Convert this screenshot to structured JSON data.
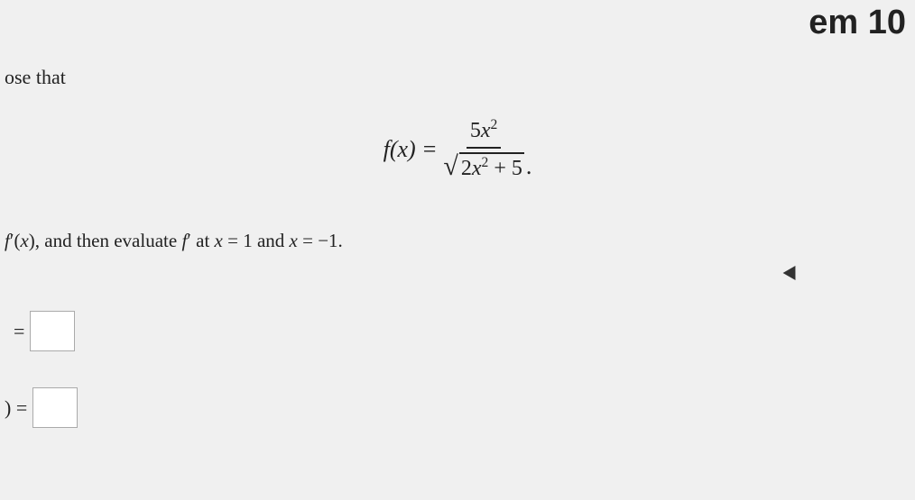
{
  "page": {
    "background_color": "#efefef",
    "top_heading": "em 10",
    "intro_text": "ose that",
    "formula": {
      "lhs": "f(x)",
      "equals": "=",
      "numerator": "5x²",
      "denominator_sqrt_content": "2x² + 5",
      "period": "."
    },
    "instruction_line": "f′(x), and then evaluate f′ at x = 1 and x = −1.",
    "answer_row1_label": "=",
    "answer_row2_label": ") =",
    "answer_box1_value": "",
    "answer_box2_value": ""
  }
}
